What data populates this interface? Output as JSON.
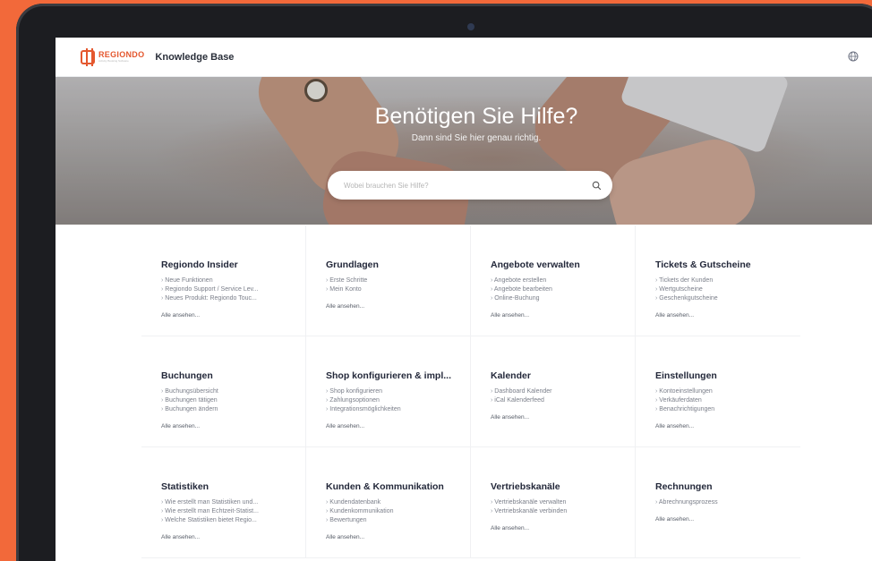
{
  "header": {
    "brand": "REGIONDO",
    "brand_tagline": "Activity Booking Software",
    "title": "Knowledge Base"
  },
  "hero": {
    "title": "Benötigen Sie Hilfe?",
    "subtitle": "Dann sind Sie hier genau richtig.",
    "search_placeholder": "Wobei brauchen Sie Hilfe?"
  },
  "colors": {
    "background": "#f2693a",
    "brand": "#e4572e",
    "card_title": "#23283a"
  },
  "see_all_label": "Alle ansehen...",
  "categories": [
    {
      "title": "Regiondo Insider",
      "links": [
        "Neue Funktionen",
        "Regiondo Support / Service Lev...",
        "Neues Produkt: Regiondo Touc..."
      ]
    },
    {
      "title": "Grundlagen",
      "links": [
        "Erste Schritte",
        "Mein Konto",
        ""
      ]
    },
    {
      "title": "Angebote verwalten",
      "links": [
        "Angebote erstellen",
        "Angebote bearbeiten",
        "Online-Buchung"
      ]
    },
    {
      "title": "Tickets & Gutscheine",
      "links": [
        "Tickets der Kunden",
        "Wertgutscheine",
        "Geschenkgutscheine"
      ]
    },
    {
      "title": "Buchungen",
      "links": [
        "Buchungsübersicht",
        "Buchungen tätigen",
        "Buchungen ändern"
      ]
    },
    {
      "title": "Shop konfigurieren & impl...",
      "links": [
        "Shop konfigurieren",
        "Zahlungsoptionen",
        "Integrationsmöglichkeiten"
      ]
    },
    {
      "title": "Kalender",
      "links": [
        "Dashboard Kalender",
        "iCal Kalenderfeed",
        ""
      ]
    },
    {
      "title": "Einstellungen",
      "links": [
        "Kontoeinstellungen",
        "Verkäuferdaten",
        "Benachrichtigungen"
      ]
    },
    {
      "title": "Statistiken",
      "links": [
        "Wie erstellt man Statistiken und...",
        "Wie erstellt man Echtzeit-Statist...",
        "Welche Statistiken bietet Regio..."
      ]
    },
    {
      "title": "Kunden & Kommunikation",
      "links": [
        "Kundendatenbank",
        "Kundenkommunikation",
        "Bewertungen"
      ]
    },
    {
      "title": "Vertriebskanäle",
      "links": [
        "Vertriebskanäle verwalten",
        "Vertriebskanäle verbinden",
        ""
      ]
    },
    {
      "title": "Rechnungen",
      "links": [
        "Abrechnungsprozess",
        "",
        ""
      ]
    }
  ]
}
